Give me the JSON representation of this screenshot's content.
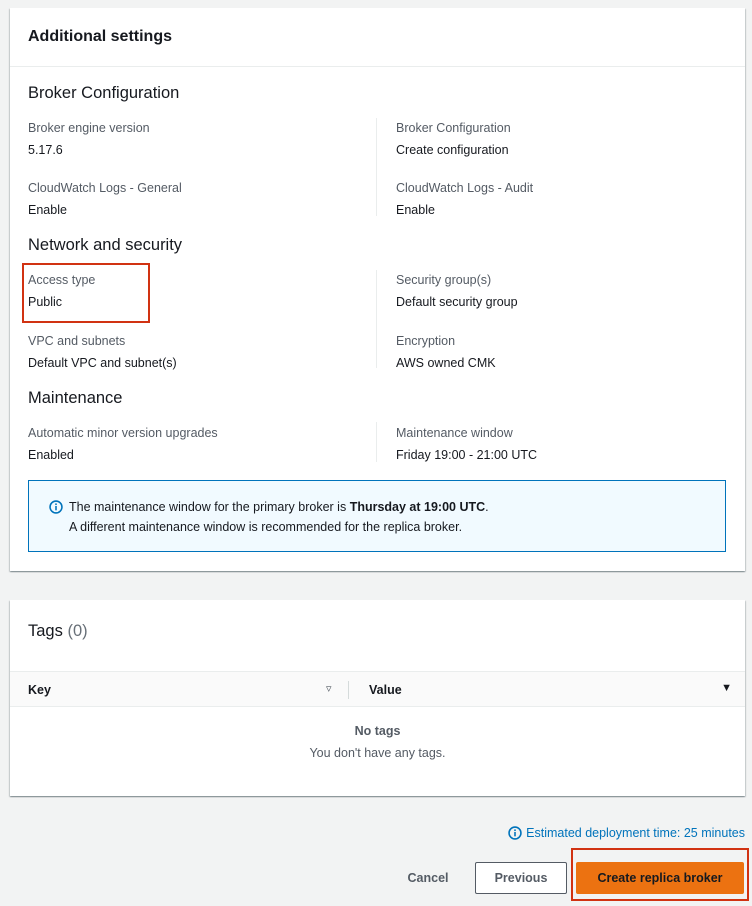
{
  "additional_settings": {
    "header": "Additional settings",
    "broker_configuration_section": {
      "title": "Broker Configuration",
      "engine_version_label": "Broker engine version",
      "engine_version_value": "5.17.6",
      "configuration_label": "Broker Configuration",
      "configuration_value": "Create configuration",
      "cw_general_label": "CloudWatch Logs - General",
      "cw_general_value": "Enable",
      "cw_audit_label": "CloudWatch Logs - Audit",
      "cw_audit_value": "Enable"
    },
    "network_section": {
      "title": "Network and security",
      "access_type_label": "Access type",
      "access_type_value": "Public",
      "security_groups_label": "Security group(s)",
      "security_groups_value": "Default security group",
      "vpc_label": "VPC and subnets",
      "vpc_value": "Default VPC and subnet(s)",
      "encryption_label": "Encryption",
      "encryption_value": "AWS owned CMK"
    },
    "maintenance_section": {
      "title": "Maintenance",
      "auto_upgrade_label": "Automatic minor version upgrades",
      "auto_upgrade_value": "Enabled",
      "window_label": "Maintenance window",
      "window_value": "Friday 19:00 - 21:00 UTC"
    },
    "info_alert": {
      "line1_prefix": "The maintenance window for the primary broker is ",
      "line1_bold": "Thursday at 19:00 UTC",
      "line1_suffix": ".",
      "line2": "A different maintenance window is recommended for the replica broker.",
      "icon": "info-icon"
    }
  },
  "tags": {
    "title": "Tags",
    "count": "(0)",
    "columns": [
      "Key",
      "Value"
    ],
    "empty_title": "No tags",
    "empty_subtitle": "You don't have any tags."
  },
  "footer": {
    "estimate_text": "Estimated deployment time: 25 minutes",
    "cancel_label": "Cancel",
    "previous_label": "Previous",
    "create_label": "Create replica broker"
  },
  "colors": {
    "accent_orange": "#ec7211",
    "link_blue": "#0073bb",
    "highlight_red": "#d13212"
  }
}
